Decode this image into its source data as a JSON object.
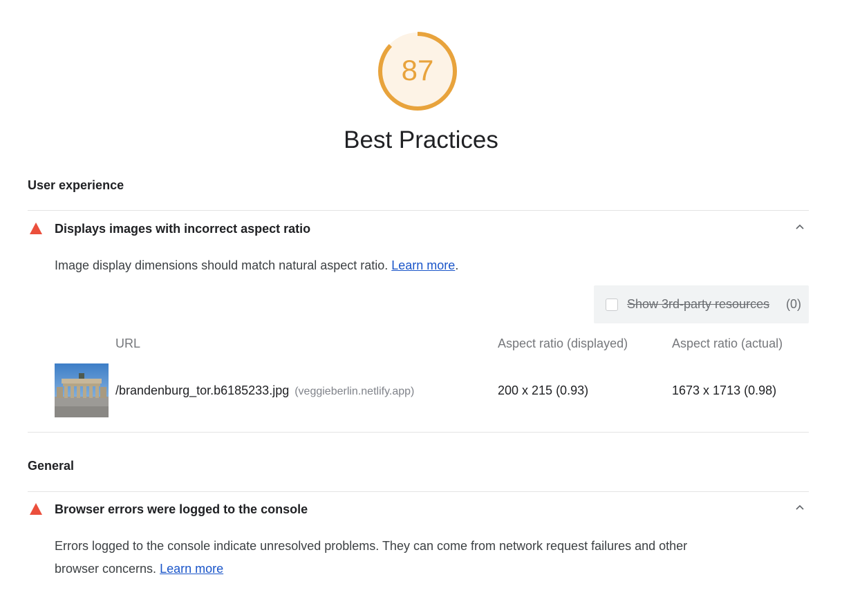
{
  "score": {
    "value": "87",
    "fraction": 0.87,
    "color": "#e8a33c",
    "track_color": "#fdf3e6"
  },
  "category": {
    "title": "Best Practices"
  },
  "groups": [
    {
      "title": "User experience",
      "audit": {
        "status_icon": "warning-triangle-icon",
        "status_color": "#eb4f3c",
        "title": "Displays images with incorrect aspect ratio",
        "description": "Image display dimensions should match natural aspect ratio. ",
        "learn_more": "Learn more",
        "trailing": ".",
        "expand_icon": "chevron-up-icon",
        "third_party": {
          "label": "Show 3rd-party resources",
          "count": "(0)"
        },
        "table": {
          "columns": [
            "URL",
            "Aspect ratio (displayed)",
            "Aspect ratio (actual)"
          ],
          "rows": [
            {
              "thumbnail": "image-thumbnail",
              "url": "/brandenburg_tor.b6185233.jpg",
              "host": "(veggieberlin.netlify.app)",
              "displayed": "200 x 215 (0.93)",
              "actual": "1673 x 1713 (0.98)"
            }
          ]
        }
      }
    },
    {
      "title": "General",
      "audit": {
        "status_icon": "warning-triangle-icon",
        "status_color": "#eb4f3c",
        "title": "Browser errors were logged to the console",
        "description_line1": "Errors logged to the console indicate unresolved problems. They can come from network request failures and other",
        "description_line2": "browser concerns. ",
        "learn_more": "Learn more",
        "expand_icon": "chevron-up-icon"
      }
    }
  ]
}
